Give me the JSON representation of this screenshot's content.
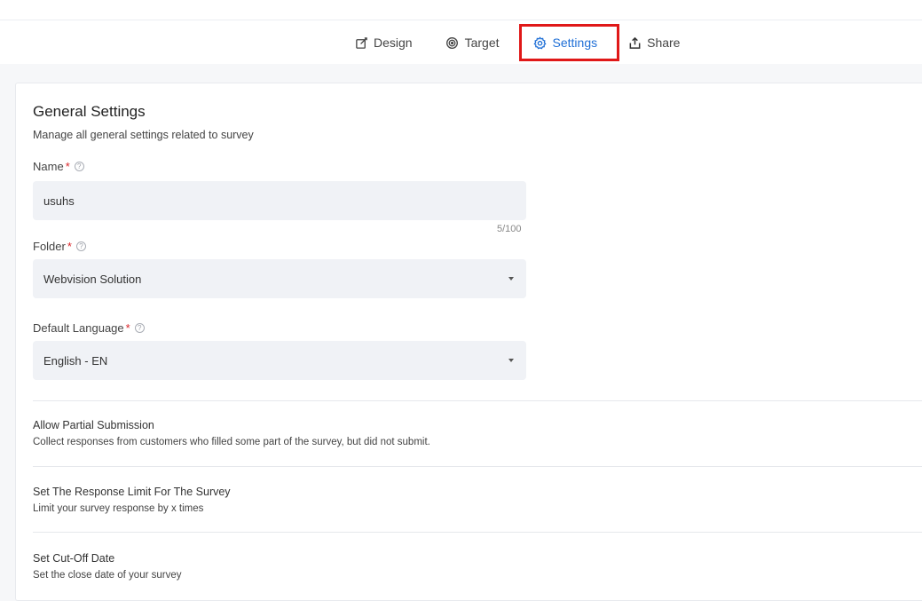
{
  "tabs": [
    {
      "label": "Design",
      "icon": "edit-icon"
    },
    {
      "label": "Target",
      "icon": "target-icon"
    },
    {
      "label": "Settings",
      "icon": "gear-icon",
      "active": true
    },
    {
      "label": "Share",
      "icon": "share-icon"
    }
  ],
  "colors": {
    "accent": "#1f6fd6",
    "highlight_border": "#e01818",
    "required": "#d9262a",
    "field_bg": "#f0f2f6"
  },
  "general": {
    "title": "General Settings",
    "subtitle": "Manage all general settings related to survey"
  },
  "fields": {
    "name": {
      "label": "Name",
      "required_mark": "*",
      "help": "?",
      "value": "usuhs",
      "counter": "5/100"
    },
    "folder": {
      "label": "Folder",
      "required_mark": "*",
      "help": "?",
      "value": "Webvision Solution"
    },
    "language": {
      "label": "Default Language",
      "required_mark": "*",
      "help": "?",
      "value": "English - EN"
    }
  },
  "options": [
    {
      "title": "Allow Partial Submission",
      "description": "Collect responses from customers who filled some part of the survey, but did not submit."
    },
    {
      "title": "Set The Response Limit For The Survey",
      "description": "Limit your survey response by x times"
    },
    {
      "title": "Set Cut-Off Date",
      "description": "Set the close date of your survey"
    }
  ]
}
